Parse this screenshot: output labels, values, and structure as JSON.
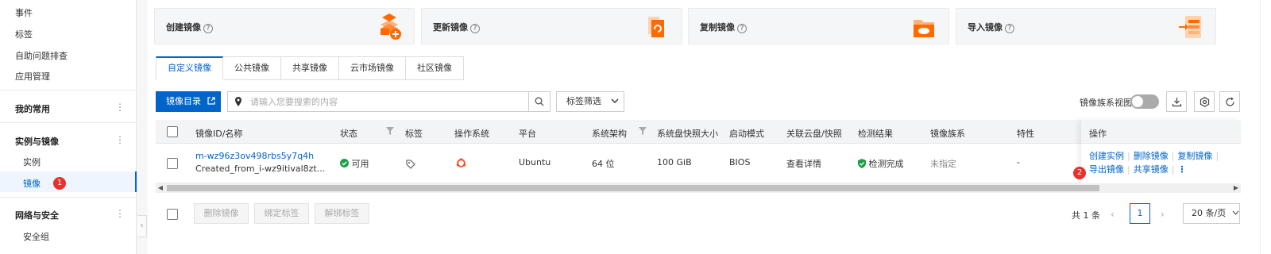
{
  "sidebar": {
    "items": [
      {
        "label": "事件"
      },
      {
        "label": "标签"
      },
      {
        "label": "自助问题排查"
      },
      {
        "label": "应用管理"
      }
    ],
    "groups": [
      {
        "label": "我的常用"
      },
      {
        "label": "实例与镜像",
        "children": [
          {
            "label": "实例"
          },
          {
            "label": "镜像",
            "active": true,
            "badge": "1"
          }
        ]
      },
      {
        "label": "网络与安全",
        "children": [
          {
            "label": "安全组"
          }
        ]
      }
    ]
  },
  "cards": [
    {
      "label": "创建镜像",
      "icon": "create-image-icon"
    },
    {
      "label": "更新镜像",
      "icon": "update-image-icon"
    },
    {
      "label": "复制镜像",
      "icon": "copy-image-icon"
    },
    {
      "label": "导入镜像",
      "icon": "import-image-icon"
    }
  ],
  "tabs": [
    {
      "label": "自定义镜像",
      "active": true
    },
    {
      "label": "公共镜像"
    },
    {
      "label": "共享镜像"
    },
    {
      "label": "云市场镜像"
    },
    {
      "label": "社区镜像"
    }
  ],
  "toolbar": {
    "catalog_label": "镜像目录",
    "search_placeholder": "请输入您要搜索的内容",
    "tag_filter_label": "标签筛选",
    "family_view_label": "镜像族系视图",
    "family_view_on": false
  },
  "table": {
    "columns": [
      "镜像ID/名称",
      "状态",
      "标签",
      "操作系统",
      "平台",
      "系统架构",
      "系统盘快照大小",
      "启动模式",
      "关联云盘/快照",
      "检测结果",
      "镜像族系",
      "特性",
      "操作"
    ],
    "rows": [
      {
        "id": "m-wz96z3ov498rbs5y7q4h",
        "name": "Created_from_i-wz9itival8zt...",
        "status": "可用",
        "platform": "Ubuntu",
        "arch": "64 位",
        "size": "100 GiB",
        "boot_mode": "BIOS",
        "linked": "查看详情",
        "check": "检测完成",
        "family": "未指定",
        "feature": "-",
        "actions": [
          "创建实例",
          "删除镜像",
          "复制镜像",
          "导出镜像",
          "共享镜像"
        ],
        "badge": "2"
      }
    ]
  },
  "footer": {
    "bulk_actions": [
      "删除镜像",
      "绑定标签",
      "解绑标签"
    ],
    "total": "共 1 条",
    "current_page": "1",
    "page_size": "20 条/页"
  },
  "colors": {
    "primary": "#0064c8",
    "success": "#1e9e49",
    "badge": "#e5322d",
    "os": "#e95420"
  }
}
